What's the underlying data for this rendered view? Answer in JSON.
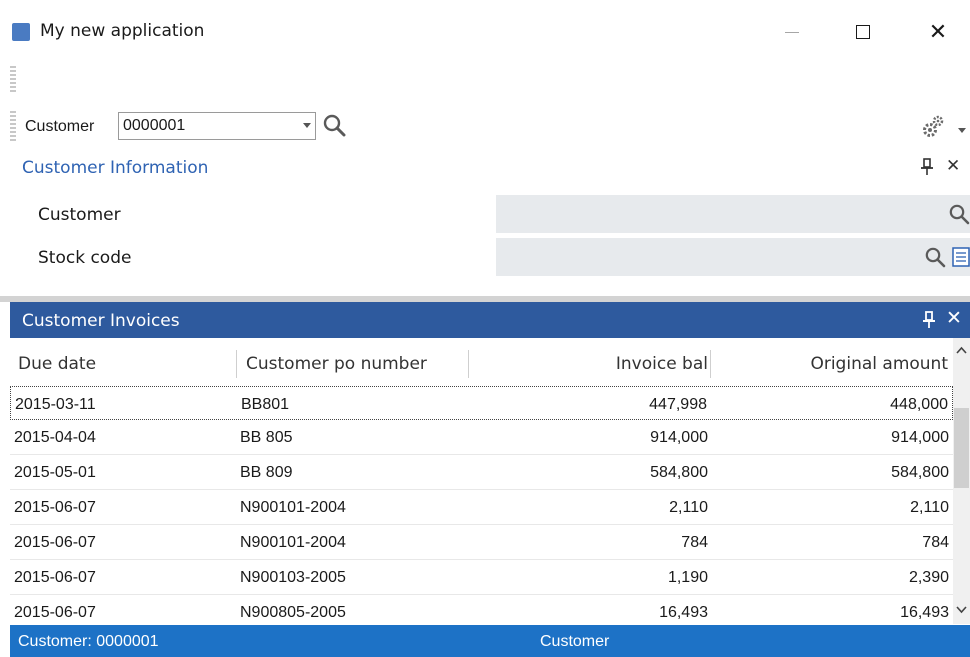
{
  "window": {
    "title": "My new application",
    "minimize_icon": "minimize-icon",
    "maximize_icon": "maximize-icon",
    "close_glyph": "✕"
  },
  "customer_selector": {
    "label": "Customer",
    "value": "0000001",
    "search_icon": "search-icon"
  },
  "customer_information": {
    "title": "Customer Information",
    "fields": [
      {
        "label": "Customer",
        "value": ""
      },
      {
        "label": "Stock code",
        "value": ""
      }
    ]
  },
  "invoices": {
    "title": "Customer Invoices",
    "columns": {
      "due_date": "Due date",
      "po_number": "Customer po number",
      "invoice_bal": "Invoice bal",
      "original_amount": "Original amount"
    },
    "rows": [
      {
        "due_date": "2015-03-11",
        "po_number": "BB801",
        "invoice_bal": "447,998",
        "original_amount": "448,000"
      },
      {
        "due_date": "2015-04-04",
        "po_number": "BB 805",
        "invoice_bal": "914,000",
        "original_amount": "914,000"
      },
      {
        "due_date": "2015-05-01",
        "po_number": "BB 809",
        "invoice_bal": "584,800",
        "original_amount": "584,800"
      },
      {
        "due_date": "2015-06-07",
        "po_number": "N900101-2004",
        "invoice_bal": "2,110",
        "original_amount": "2,110"
      },
      {
        "due_date": "2015-06-07",
        "po_number": "N900101-2004",
        "invoice_bal": "784",
        "original_amount": "784"
      },
      {
        "due_date": "2015-06-07",
        "po_number": "N900103-2005",
        "invoice_bal": "1,190",
        "original_amount": "2,390"
      },
      {
        "due_date": "2015-06-07",
        "po_number": "N900805-2005",
        "invoice_bal": "16,493",
        "original_amount": "16,493"
      }
    ]
  },
  "status_bar": {
    "left": "Customer: 0000001",
    "middle": "Customer"
  },
  "colors": {
    "panel_header": "#2e5a9e",
    "status_bar": "#1d72c6",
    "accent_text": "#2f63b3",
    "field_bg": "#e7eaed"
  }
}
